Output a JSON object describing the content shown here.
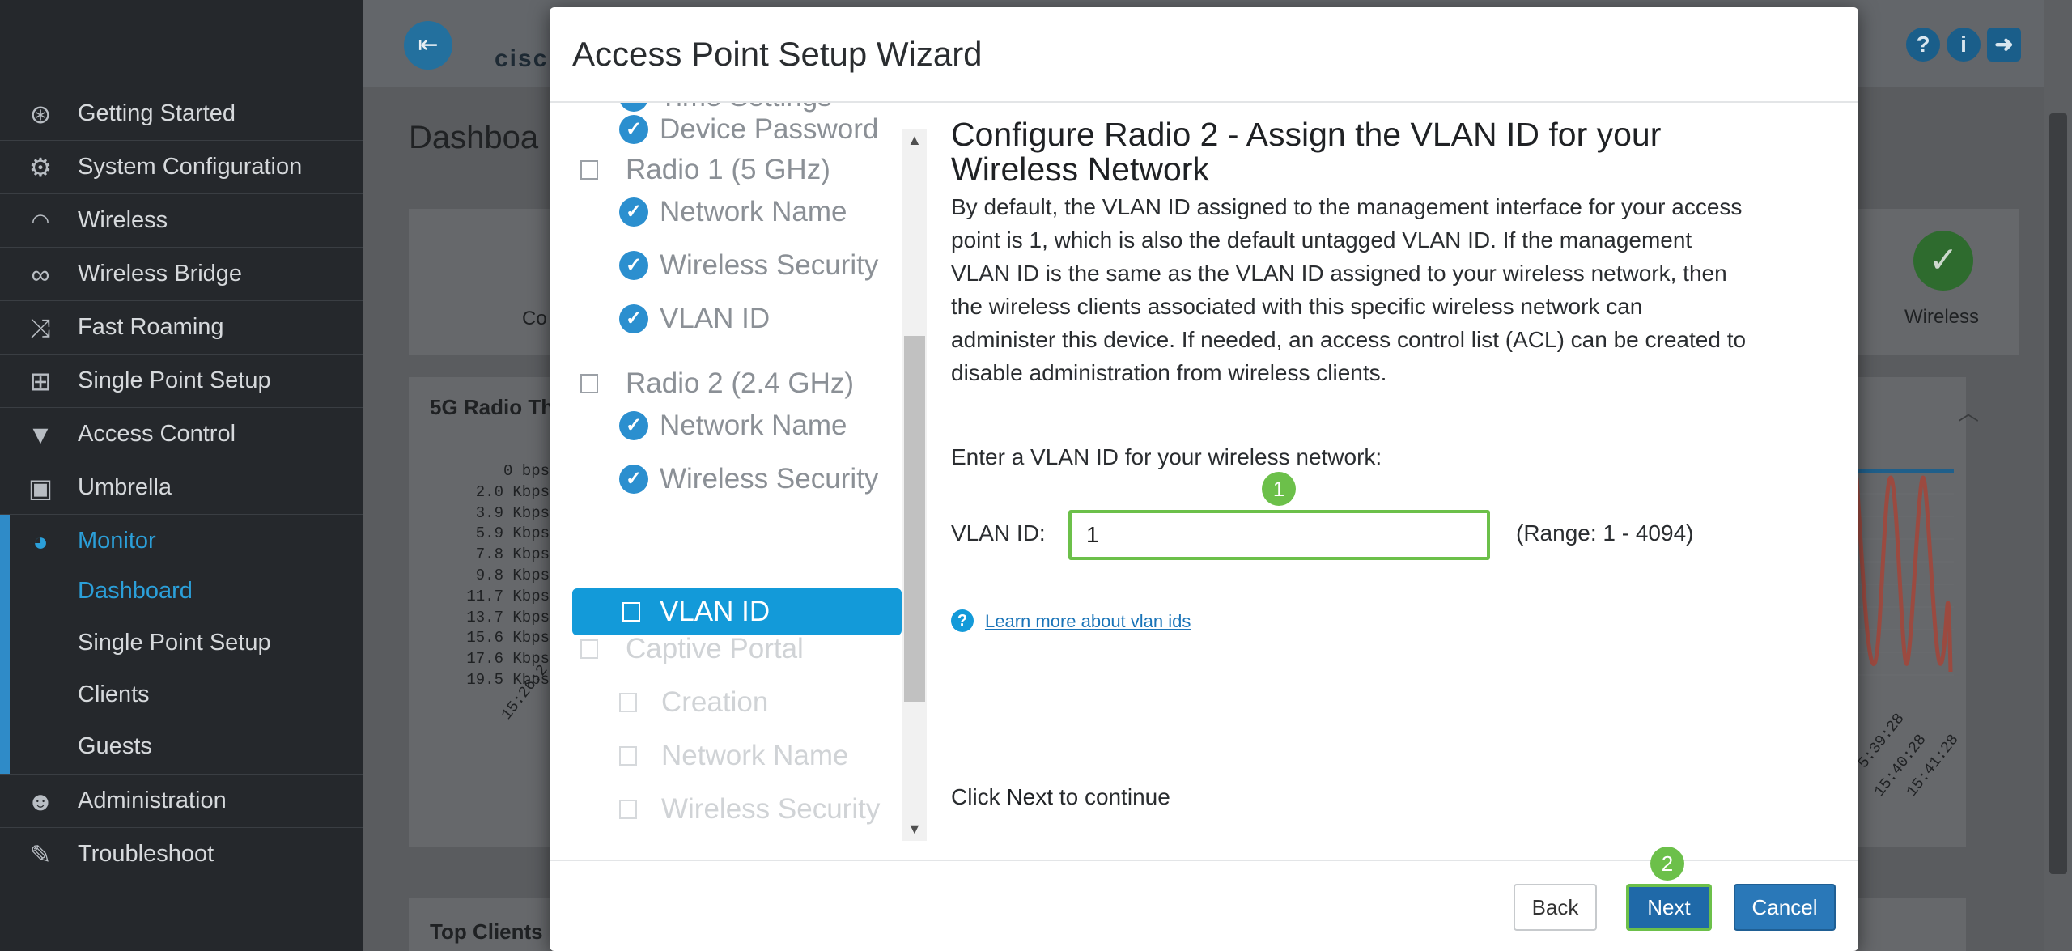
{
  "sidebar": {
    "items": [
      {
        "label": "Getting Started",
        "icon": "globe-icon"
      },
      {
        "label": "System Configuration",
        "icon": "gear-icon"
      },
      {
        "label": "Wireless",
        "icon": "wifi-icon"
      },
      {
        "label": "Wireless Bridge",
        "icon": "link-icon"
      },
      {
        "label": "Fast Roaming",
        "icon": "shuffle-icon"
      },
      {
        "label": "Single Point Setup",
        "icon": "network-icon"
      },
      {
        "label": "Access Control",
        "icon": "filter-icon"
      },
      {
        "label": "Umbrella",
        "icon": "lock-icon"
      },
      {
        "label": "Monitor",
        "icon": "pie-chart-icon"
      },
      {
        "label": "Administration",
        "icon": "users-icon"
      },
      {
        "label": "Troubleshoot",
        "icon": "wrench-icon"
      }
    ],
    "monitor_sub": [
      "Dashboard",
      "Single Point Setup",
      "Clients",
      "Guests"
    ]
  },
  "background": {
    "page_title": "Dashboa",
    "card_left_label": "Co",
    "card_right_label": "Wireless",
    "chart_panel_title": "5G Radio Th",
    "y_ticks": [
      "0 bps",
      "2.0 Kbps",
      "3.9 Kbps",
      "5.9 Kbps",
      "7.8 Kbps",
      "9.8 Kbps",
      "11.7 Kbps",
      "13.7 Kbps",
      "15.6 Kbps",
      "17.6 Kbps",
      "19.5 Kbps"
    ],
    "x_tick_left": "15:26:2",
    "x_ticks_right": [
      "5:39:28",
      "15:40:28",
      "15:41:28"
    ],
    "bottom_panel_title": "Top Clients"
  },
  "modal": {
    "title": "Access Point Setup Wizard",
    "tree": [
      {
        "label": "Time Settings",
        "state": "done"
      },
      {
        "label": "Device Password",
        "state": "done"
      },
      {
        "label": "Radio 1 (5 GHz)",
        "state": "group"
      },
      {
        "label": "Network Name",
        "state": "done"
      },
      {
        "label": "Wireless Security",
        "state": "done"
      },
      {
        "label": "VLAN ID",
        "state": "done"
      },
      {
        "label": "Radio 2 (2.4 GHz)",
        "state": "group"
      },
      {
        "label": "Network Name",
        "state": "done"
      },
      {
        "label": "Wireless Security",
        "state": "done"
      },
      {
        "label": "VLAN ID",
        "state": "selected"
      },
      {
        "label": "Captive Portal",
        "state": "disabled-group"
      },
      {
        "label": "Creation",
        "state": "disabled"
      },
      {
        "label": "Network Name",
        "state": "disabled"
      },
      {
        "label": "Wireless Security",
        "state": "disabled"
      }
    ],
    "heading": "Configure Radio 2 - Assign the VLAN ID for your Wireless Network",
    "paragraph": "By default, the VLAN ID assigned to the management interface for your access point is 1, which is also the default untagged VLAN ID. If the management VLAN ID is the same as the VLAN ID assigned to your wireless network, then the wireless clients associated with this specific wireless network can administer this device. If needed, an access control list (ACL) can be created to disable administration from wireless clients.",
    "prompt": "Enter a VLAN ID for your wireless network:",
    "vlan_label": "VLAN ID:",
    "vlan_value": "1",
    "range": "(Range: 1 - 4094)",
    "step1": "1",
    "step2": "2",
    "help_link": "Learn more about vlan ids",
    "continue_prefix": "Click ",
    "continue_bold": "Next",
    "continue_suffix": " to continue",
    "buttons": {
      "back": "Back",
      "next": "Next",
      "cancel": "Cancel"
    }
  },
  "colors": {
    "accent": "#139ad9",
    "highlight": "#6cc04a",
    "primary_button": "#2a78b8"
  }
}
